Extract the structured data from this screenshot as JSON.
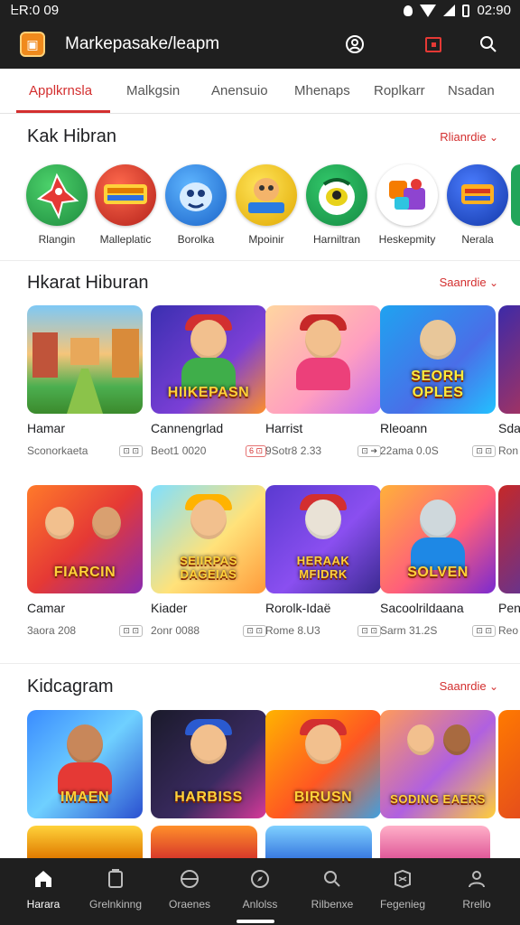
{
  "status_bar": {
    "time": "ᖶR:0 09",
    "clock_right": "02:90"
  },
  "app_bar": {
    "title": "Markepasake/leapm",
    "icons": [
      "account-icon",
      "calendar-icon",
      "search-icon"
    ]
  },
  "tabs": [
    {
      "label": "Applkrnsla",
      "active": true
    },
    {
      "label": "Malkgsin",
      "active": false
    },
    {
      "label": "Anensuio",
      "active": false
    },
    {
      "label": "Mhenaps",
      "active": false
    },
    {
      "label": "Roplkarr",
      "active": false
    },
    {
      "label": "Nsadan",
      "active": false
    }
  ],
  "sections": {
    "s1": {
      "title": "Kak Hibran",
      "see_all": "Rlianrdie"
    },
    "s2": {
      "title": "Hkarat Hiburan",
      "see_all": "Saanrdie"
    },
    "s3": {
      "title": "Kidcagram",
      "see_all": "Saanrdie"
    }
  },
  "circles": [
    {
      "label": "Rlangin",
      "color": "#2fa84f"
    },
    {
      "label": "Malleplatic",
      "color": "#d83a2a"
    },
    {
      "label": "Borolka",
      "color": "#2d8ce0"
    },
    {
      "label": "Mpoinir",
      "color": "#f2c21b"
    },
    {
      "label": "Harniltran",
      "color": "#1fa65b"
    },
    {
      "label": "Heskepmity",
      "color": "#ffffff"
    },
    {
      "label": "Nerala",
      "color": "#1f52c8"
    }
  ],
  "row1": [
    {
      "name": "Hamar",
      "meta": "Sconorkaeta",
      "badge": "⊡ ⊡"
    },
    {
      "name": "Cannengrlad",
      "meta": "Beot1 0020",
      "badge": "6 ⊡"
    },
    {
      "name": "Harrist",
      "meta": "9Sotr8 2.33",
      "badge": "⊡ ➔"
    },
    {
      "name": "Rleoann",
      "meta": "22ama 0.0S",
      "badge": "⊡ ⊡"
    },
    {
      "name": "Sda",
      "meta": "Ron",
      "badge": ""
    }
  ],
  "row1_art": [
    "",
    "HIIKEPASN",
    "",
    "SEORH OPLES",
    ""
  ],
  "row2": [
    {
      "name": "Camar",
      "meta": "3aora 208",
      "badge": "⊡ ⊡"
    },
    {
      "name": "Kiader",
      "meta": "2onr 0088",
      "badge": "⊡ ⊡"
    },
    {
      "name": "Rorolk-Idaë",
      "meta": "Rome 8.U3",
      "badge": "⊡ ⊡"
    },
    {
      "name": "Sacoolrildaana",
      "meta": "Sarm 31.2S",
      "badge": "⊡ ⊡"
    },
    {
      "name": "Pen",
      "meta": "Reo",
      "badge": ""
    }
  ],
  "row2_art": [
    "FIARCIN",
    "SEIIRPAS DAGEIAS",
    "HERAAK MFIDRK",
    "SOLVEN",
    ""
  ],
  "row3_art": [
    "IMAEN",
    "HARBISS",
    "BIRUSN",
    "SODING EAERS",
    ""
  ],
  "bottom_nav": [
    {
      "label": "Harara",
      "icon": "home-icon",
      "active": true
    },
    {
      "label": "Grelnkinng",
      "icon": "apps-icon",
      "active": false
    },
    {
      "label": "Oraenes",
      "icon": "games-icon",
      "active": false
    },
    {
      "label": "Anlolss",
      "icon": "compass-icon",
      "active": false
    },
    {
      "label": "Rilbenxe",
      "icon": "search-icon",
      "active": false
    },
    {
      "label": "Fegenieg",
      "icon": "map-icon",
      "active": false
    },
    {
      "label": "Rrello",
      "icon": "person-icon",
      "active": false
    }
  ],
  "colors": {
    "accent": "#d32f2f",
    "bar": "#1f1f1f"
  }
}
